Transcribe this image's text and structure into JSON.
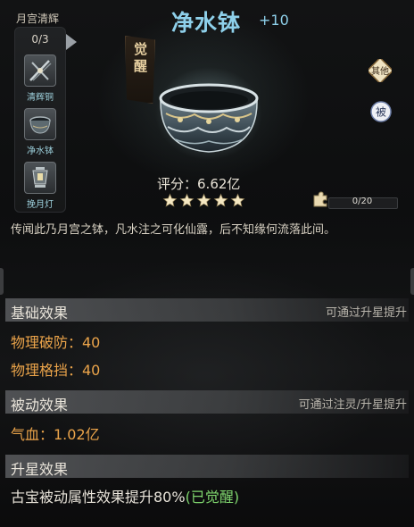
{
  "set": {
    "name": "月宫清辉",
    "count": "0/3",
    "items": [
      {
        "label": "清辉铜",
        "icon": "crossed-weapons-icon"
      },
      {
        "label": "净水钵",
        "icon": "bowl-icon"
      },
      {
        "label": "挽月灯",
        "icon": "lantern-icon"
      }
    ]
  },
  "item": {
    "title": "净水钵",
    "level": "+10",
    "awaken_badge": "觉醒",
    "score_label": "评分：",
    "score_value": "6.62亿",
    "stars": 5,
    "shards": "0/20",
    "shards_fraction": 0,
    "description": "传闻此乃月宫之钵，凡水注之可化仙露，后不知缘何流落此间。"
  },
  "buttons": {
    "other": "其他",
    "passive": "被"
  },
  "sections": {
    "base": {
      "title": "基础效果",
      "note": "可通过升星提升"
    },
    "passive": {
      "title": "被动效果",
      "note": "可通过注灵/升星提升"
    },
    "star": {
      "title": "升星效果"
    }
  },
  "stats": {
    "base": [
      {
        "label": "物理破防：40"
      },
      {
        "label": "物理格挡：40"
      }
    ],
    "passive": [
      {
        "label": "气血：1.02亿"
      }
    ]
  },
  "star_effect": {
    "text": "古宝被动属性效果提升80%",
    "status": "(已觉醒)"
  },
  "colors": {
    "title": "#8ed0ea",
    "stat": "#eba44a",
    "awakened": "#7fd66e",
    "star": "#f4e7c2"
  }
}
